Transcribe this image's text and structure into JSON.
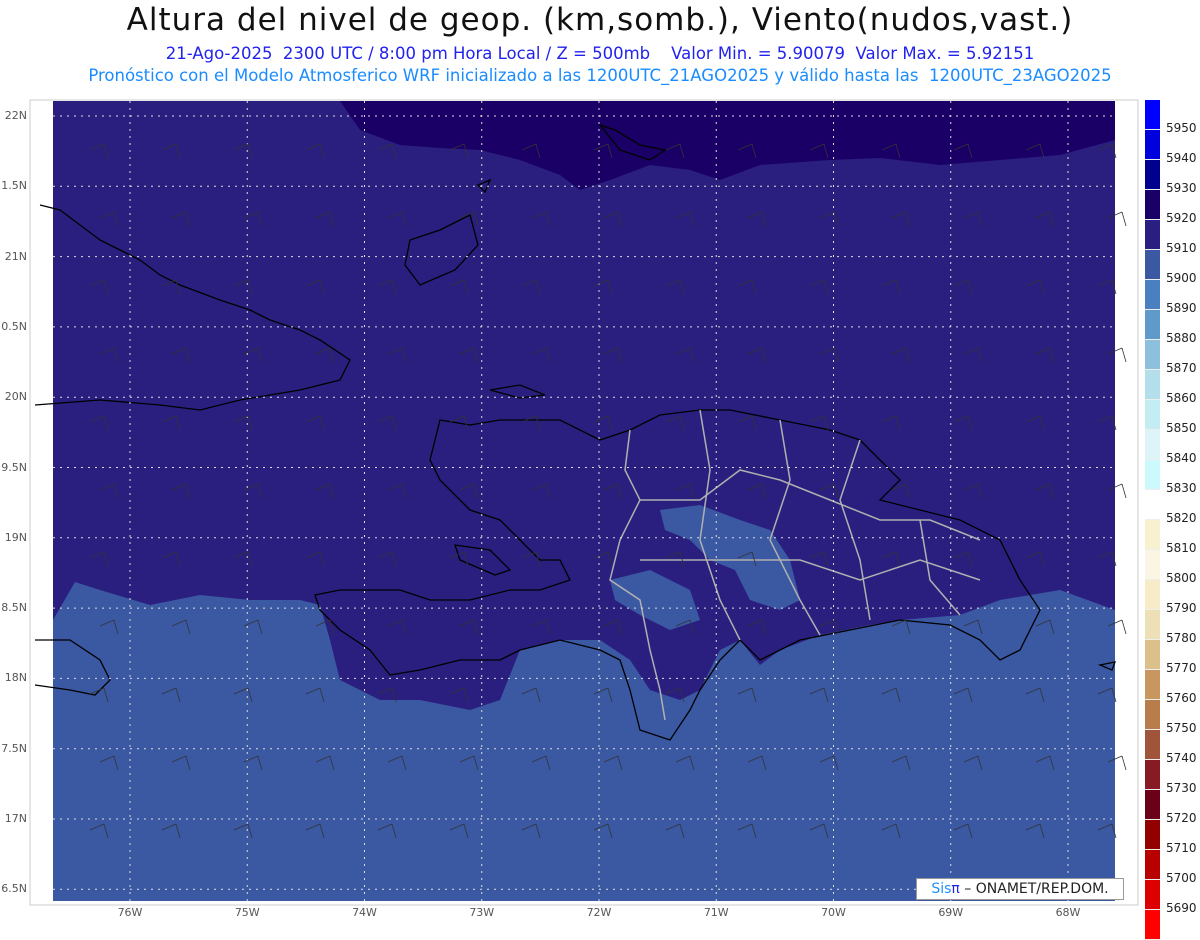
{
  "title": "Altura del nivel de geop. (km,somb.), Viento(nudos,vast.)",
  "subtitle": "21-Ago-2025  2300 UTC / 8:00 pm Hora Local / Z = 500mb    Valor Min. = 5.90079  Valor Max. = 5.92151",
  "forecast_info": "Pronóstico con el Modelo Atmosferico WRF inicializado a las 1200UTC_21AGO2025 y válido hasta las  1200UTC_23AGO2025",
  "lat_labels": [
    "22N",
    "1.5N",
    "21N",
    "0.5N",
    "20N",
    "9.5N",
    "19N",
    "8.5N",
    "18N",
    "7.5N",
    "17N",
    "6.5N"
  ],
  "lon_labels": [
    "76W",
    "75W",
    "74W",
    "73W",
    "72W",
    "71W",
    "70W",
    "69W",
    "68W"
  ],
  "colorbar": {
    "labels": [
      "5950",
      "5940",
      "5930",
      "5920",
      "5910",
      "5900",
      "5890",
      "5880",
      "5870",
      "5860",
      "5850",
      "5840",
      "5830",
      "5820",
      "5810",
      "5800",
      "5790",
      "5780",
      "5770",
      "5760",
      "5750",
      "5740",
      "5730",
      "5720",
      "5710",
      "5700",
      "5690"
    ],
    "colors": [
      "#0000ff",
      "#0000dd",
      "#00008f",
      "#1a0066",
      "#2a1f80",
      "#3b58a3",
      "#4a80bf",
      "#5f9acb",
      "#8cc0dd",
      "#b2dfea",
      "#c4ecf3",
      "#ddf4f8",
      "#ccfafc",
      "#ffffff",
      "#f8f1d0",
      "#fbf5e3",
      "#f6ecc8",
      "#ede0b6",
      "#dcc08c",
      "#c8965f",
      "#b87d4b",
      "#a0553b",
      "#861a25",
      "#6b0019",
      "#920000",
      "#b80000",
      "#dc0000",
      "#ff0000"
    ]
  },
  "logo": {
    "sis": "Sis",
    "pi": "π",
    "text": " – ONAMET/REP.DOM."
  }
}
